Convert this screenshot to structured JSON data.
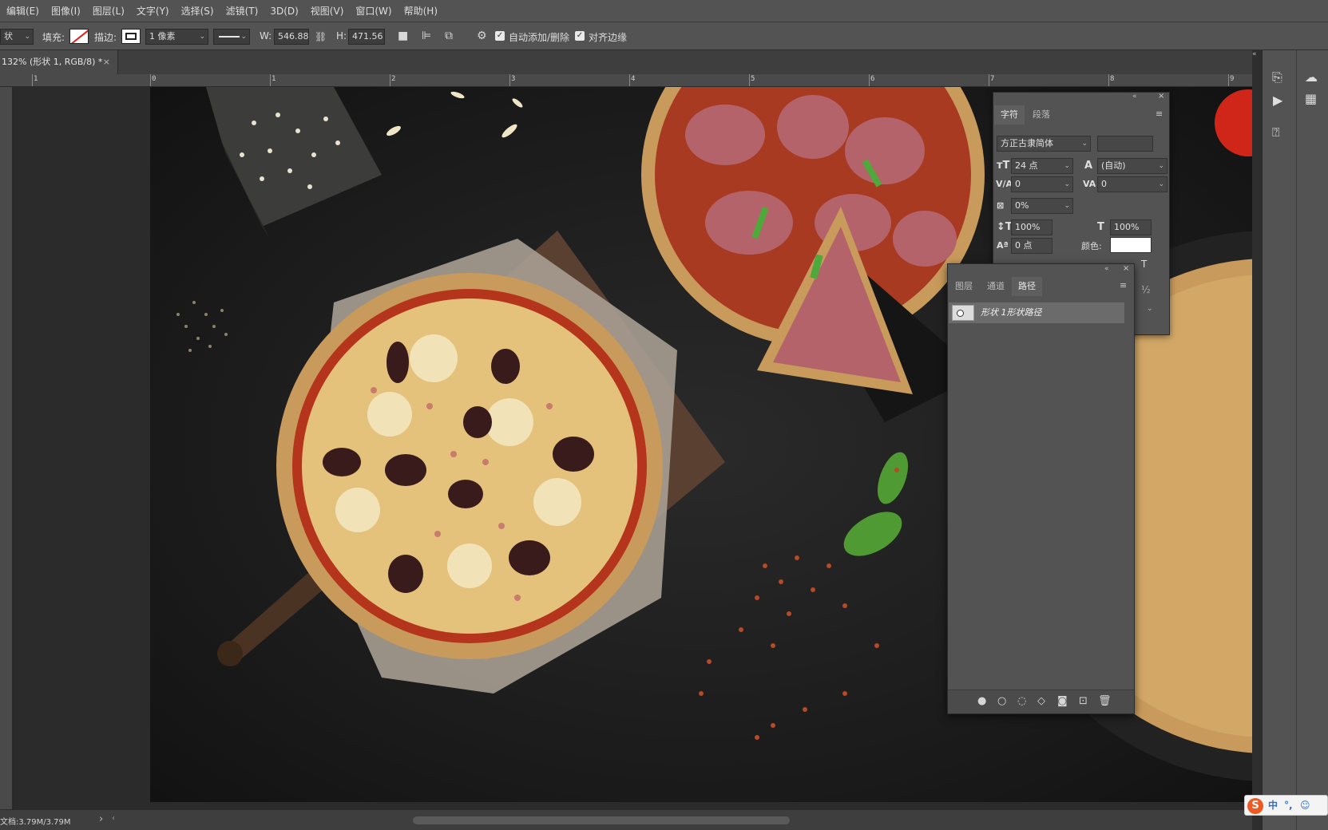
{
  "menu": [
    "编辑(E)",
    "图像(I)",
    "图层(L)",
    "文字(Y)",
    "选择(S)",
    "滤镜(T)",
    "3D(D)",
    "视图(V)",
    "窗口(W)",
    "帮助(H)"
  ],
  "options": {
    "tool_mode": "状",
    "fill_label": "填充:",
    "stroke_label": "描边:",
    "stroke_width": "1 像素",
    "w_label": "W:",
    "w_value": "546.88 |",
    "h_label": "H:",
    "h_value": "471.56 |",
    "auto_add_delete": "自动添加/删除",
    "align_edges": "对齐边缘"
  },
  "document_tab": {
    "title": "132% (形状 1, RGB/8) *",
    "close": "×"
  },
  "ruler": {
    "labels": [
      "1",
      "0",
      "1",
      "2",
      "3",
      "4",
      "5",
      "6",
      "7",
      "8",
      "9"
    ]
  },
  "character_panel": {
    "tabs": [
      "字符",
      "段落"
    ],
    "font_family": "方正古隶简体",
    "font_size": "24 点",
    "leading": "(自动)",
    "kerning": "0",
    "tracking": "0",
    "tsume": "0%",
    "vertical_scale": "100%",
    "horizontal_scale": "100%",
    "baseline_shift": "0 点",
    "color_label": "颜色:",
    "color_value": "#ffffff"
  },
  "paths_panel": {
    "tabs": [
      "图层",
      "通道",
      "路径"
    ],
    "path_item": "形状 1形状路径"
  },
  "status": {
    "doc_size": "文档:3.79M/3.79M",
    "arrow": "›"
  },
  "ime": {
    "logo": "S",
    "lang": "中",
    "punct": "°,",
    "emoji": "☺"
  },
  "icons": {
    "fill_swatch": "no-fill-swatch-icon",
    "stroke_swatch": "stroke-swatch-icon",
    "gear": "gear-icon",
    "link": "link-icon",
    "path_ops": "path-operations-icon",
    "path_align": "path-alignment-icon",
    "path_arrange": "path-arrangement-icon"
  }
}
